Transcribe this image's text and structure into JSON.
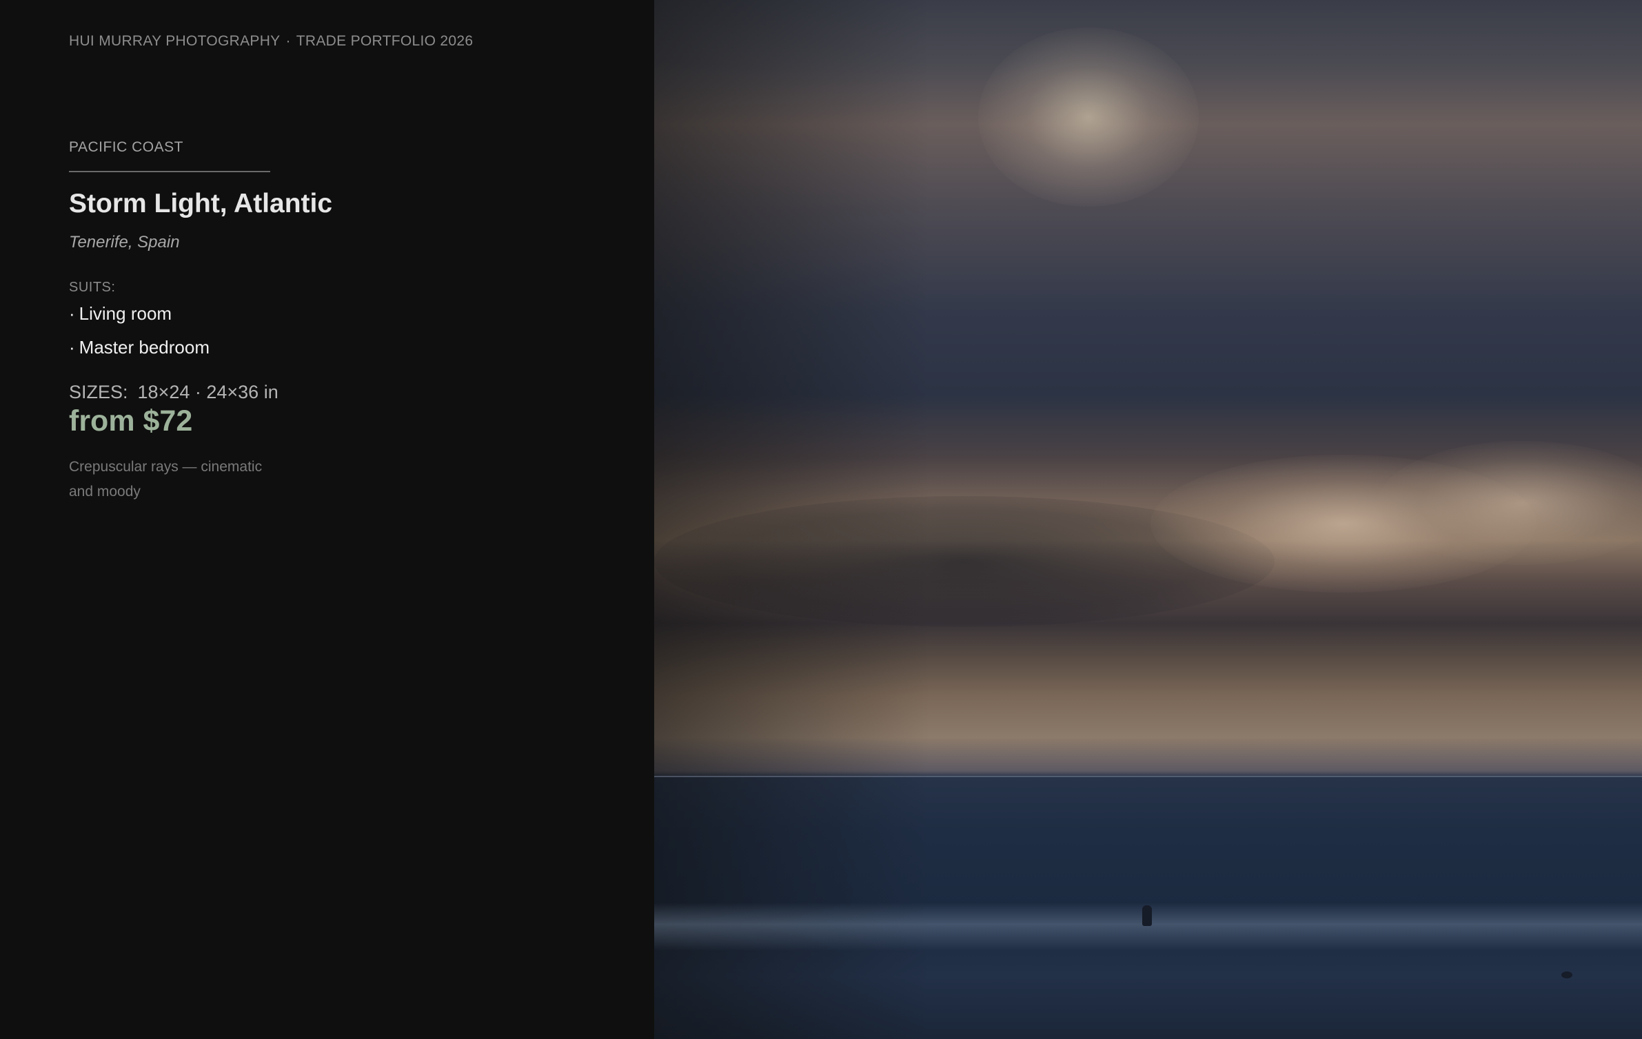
{
  "header": {
    "studio": "HUI MURRAY PHOTOGRAPHY",
    "separator": "·",
    "portfolio": "TRADE PORTFOLIO 2026"
  },
  "artwork": {
    "category": "PACIFIC COAST",
    "title": "Storm Light, Atlantic",
    "location": "Tenerife, Spain",
    "suits_label": "SUITS:",
    "suits": [
      {
        "bullet": "·",
        "label": "Living room"
      },
      {
        "bullet": "·",
        "label": "Master bedroom"
      }
    ],
    "sizes_label": "SIZES:",
    "sizes": "18×24 · 24×36 in",
    "price": "from $72",
    "description": "Crepuscular rays — cinematic and moody"
  },
  "colors": {
    "background": "#0f0f0f",
    "price_accent": "#9db29a",
    "title": "#e6e6e6"
  }
}
